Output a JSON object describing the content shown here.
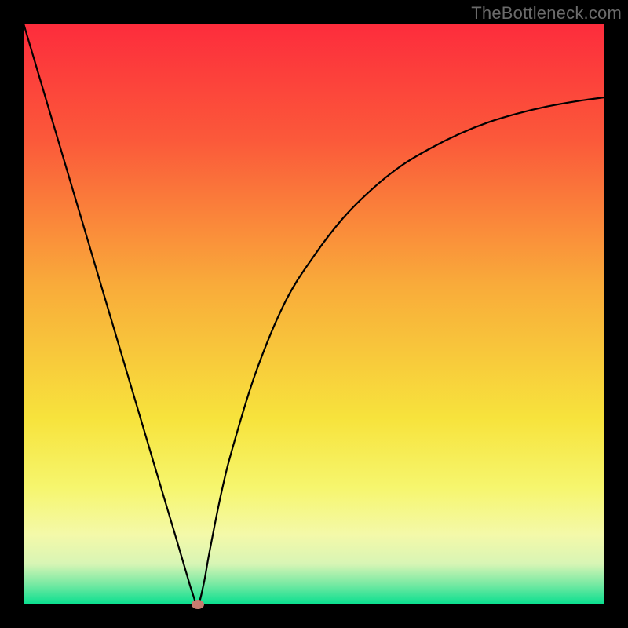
{
  "watermark": "TheBottleneck.com",
  "colors": {
    "frame": "#000000",
    "curve": "#000000",
    "marker": "#c77a6f",
    "gradient_stops": [
      {
        "pct": 0,
        "color": "#fd2c3c"
      },
      {
        "pct": 20,
        "color": "#fb593a"
      },
      {
        "pct": 45,
        "color": "#f9ab3a"
      },
      {
        "pct": 68,
        "color": "#f7e33c"
      },
      {
        "pct": 80,
        "color": "#f6f66e"
      },
      {
        "pct": 88,
        "color": "#f4f9a9"
      },
      {
        "pct": 93,
        "color": "#d8f5b5"
      },
      {
        "pct": 96.5,
        "color": "#78e9a3"
      },
      {
        "pct": 100,
        "color": "#08df8f"
      }
    ]
  },
  "chart_data": {
    "type": "line",
    "title": "",
    "xlabel": "",
    "ylabel": "",
    "xlim": [
      0,
      100
    ],
    "ylim": [
      0,
      100
    ],
    "annotations": [
      "TheBottleneck.com"
    ],
    "series": [
      {
        "name": "bottleneck-curve",
        "x": [
          0,
          4,
          8,
          12,
          16,
          20,
          24,
          26,
          28,
          29,
          30,
          31,
          32,
          34,
          36,
          40,
          45,
          50,
          55,
          60,
          65,
          70,
          75,
          80,
          85,
          90,
          95,
          100
        ],
        "values": [
          100,
          86.5,
          73,
          59.5,
          46,
          32.5,
          19,
          12.3,
          5.5,
          2.2,
          0,
          3.5,
          9,
          19,
          27,
          40,
          52,
          60,
          66.5,
          71.5,
          75.5,
          78.5,
          81,
          83,
          84.5,
          85.7,
          86.6,
          87.3
        ]
      }
    ],
    "marker": {
      "x": 30,
      "y": 0
    }
  }
}
